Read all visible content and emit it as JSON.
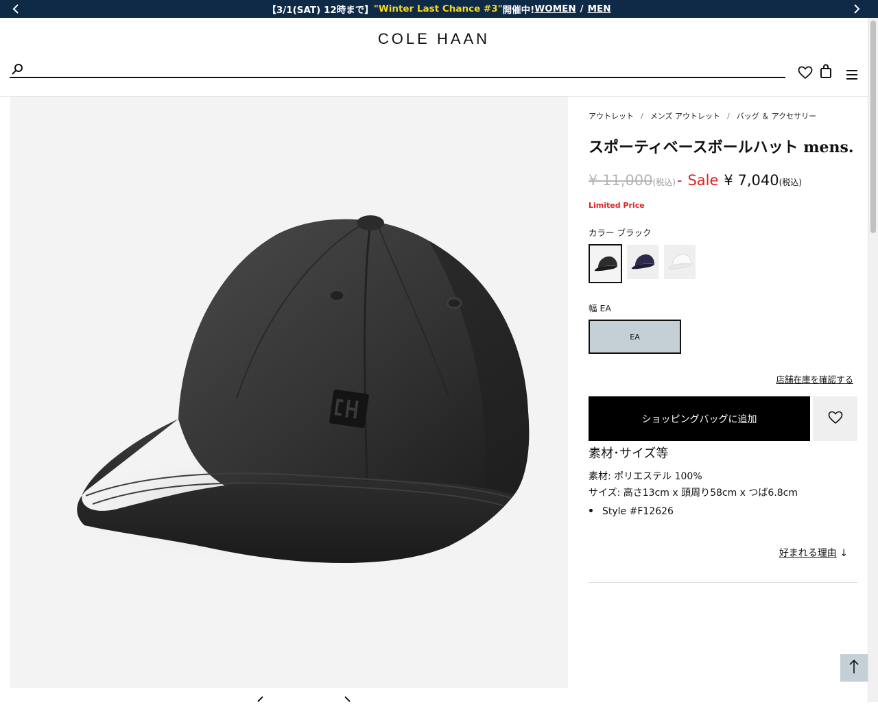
{
  "promo": {
    "date_text": "【3/1(SAT) 12時まで】",
    "campaign": "\"Winter Last Chance #3\"",
    "status": " 開催中!",
    "women_link": "WOMEN",
    "separator": "/",
    "men_link": "MEN"
  },
  "header": {
    "logo": "COLE HAAN",
    "search_placeholder": ""
  },
  "breadcrumb": [
    "アウトレット",
    "メンズ アウトレット",
    "バッグ ＆ アクセサリー"
  ],
  "breadcrumb_separator": "/",
  "product": {
    "title": "スポーティベースボールハット mens.",
    "original_price": "¥ 11,000",
    "original_tax": "(税込)",
    "sale_dash": "-",
    "sale_label": "Sale",
    "sale_price": "¥ 7,040",
    "sale_tax": "(税込)",
    "limited": "Limited Price",
    "color_label": "カラー ブラック",
    "colors": [
      {
        "name": "black",
        "hex": "#2d2d2d"
      },
      {
        "name": "navy",
        "hex": "#2c2a4a"
      },
      {
        "name": "white",
        "hex": "#e6e6e6"
      }
    ],
    "width_label": "幅 EA",
    "width_option": "EA",
    "stock_link": "店舗在庫を確認する",
    "add_to_bag": "ショッピングバッグに追加"
  },
  "specs": {
    "title": "素材･サイズ等",
    "material": "素材: ポリエステル 100%",
    "size": "サイズ: 高さ13cm x 頭周り58cm x つば6.8cm",
    "style": "Style #F12626",
    "reason_link": "好まれる理由",
    "reason_arrow": "↓"
  },
  "colors": {
    "promo_bg": "#0e2a47",
    "promo_highlight": "#f5d820",
    "sale_red": "#d22222",
    "width_selected_bg": "#c4cfd6"
  }
}
